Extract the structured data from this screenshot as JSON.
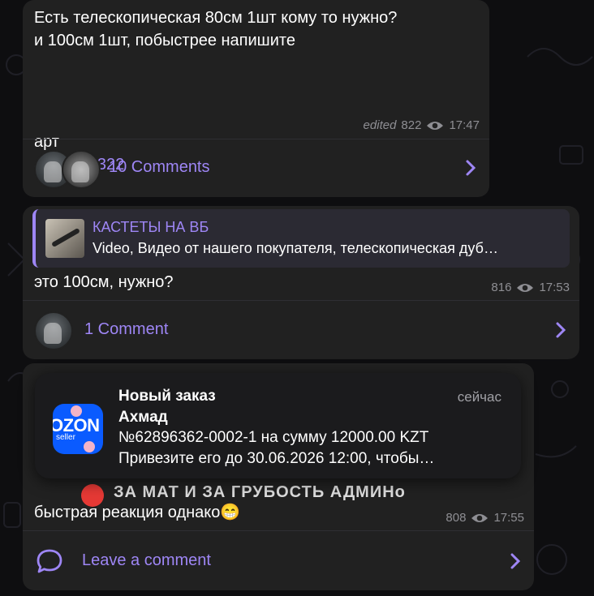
{
  "messages": [
    {
      "text": "Есть телескопическая 80см 1шт кому то нужно?\nи 100см 1шт, побыстрее напишите",
      "art_prefix": "арт",
      "art_link": "4906461322",
      "edited": "edited",
      "views": "822",
      "time": "17:47",
      "comments_label": "10 Comments"
    },
    {
      "reply_title": "КАСТЕТЫ НА ВБ",
      "reply_sub": "Video, Видео от нашего покупателя, телескопическая дуб…",
      "text": "это 100см, нужно?",
      "views": "816",
      "time": "17:53",
      "comments_label": "1 Comment"
    },
    {
      "text": "быстрая реакция однако😁",
      "views": "808",
      "time": "17:55",
      "comments_label": "Leave a comment"
    }
  ],
  "notification": {
    "title": "Новый заказ",
    "time": "сейчас",
    "sender": "Ахмад",
    "line1": "№62896362-0002-1 на сумму 12000.00 KZT",
    "line2": "Привезите его до 30.06.2026 12:00, чтобы…",
    "app_word": "OZON",
    "app_sub": "seller"
  },
  "hidden_message_fragment": "ЗА МАТ И ЗА ГРУБОСТЬ АДМИНо",
  "colors": {
    "accent": "#9e86f5",
    "bubble": "#212121",
    "background": "#0e0e10",
    "ozon": "#0a5bff"
  }
}
